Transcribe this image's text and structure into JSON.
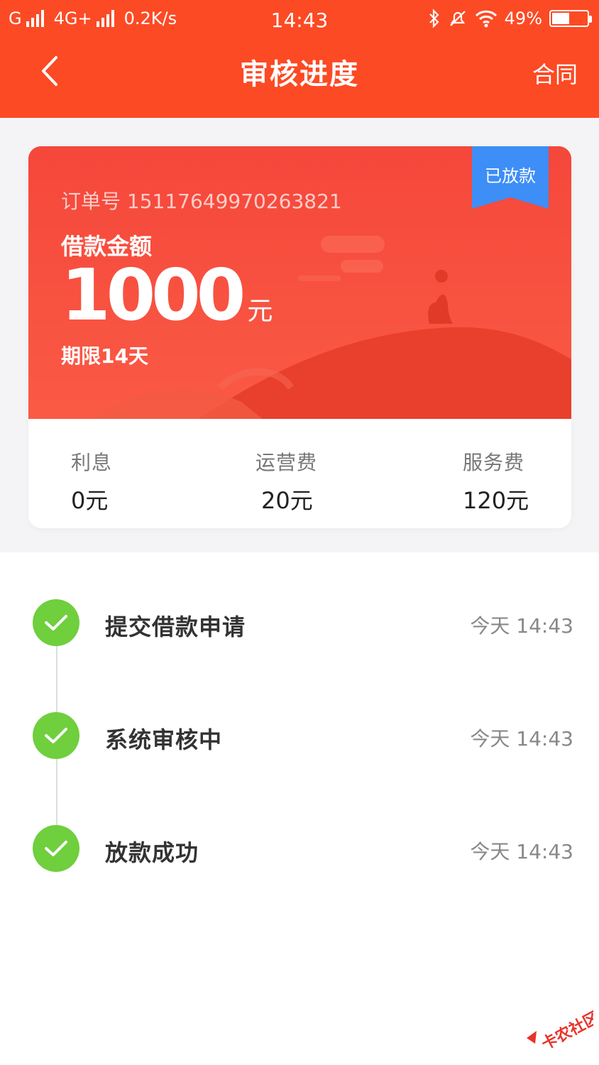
{
  "status_bar": {
    "carrier1": "G",
    "carrier2": "4G+",
    "speed": "0.2K/s",
    "time": "14:43",
    "battery": "49%",
    "battery_level": 0.49
  },
  "nav": {
    "title": "审核进度",
    "right": "合同"
  },
  "card": {
    "badge": "已放款",
    "order_label": "订单号 15117649970263821",
    "amount_label": "借款金额",
    "amount": "1000",
    "amount_unit": "元",
    "term": "期限14天",
    "fees": [
      {
        "label": "利息",
        "value": "0元"
      },
      {
        "label": "运营费",
        "value": "20元"
      },
      {
        "label": "服务费",
        "value": "120元"
      }
    ],
    "colors": {
      "card": "#f4463a",
      "badge": "#3d8ef7"
    }
  },
  "steps": [
    {
      "label": "提交借款申请",
      "time": "今天 14:43"
    },
    {
      "label": "系统审核中",
      "time": "今天 14:43"
    },
    {
      "label": "放款成功",
      "time": "今天 14:43"
    }
  ],
  "watermark": "卡农社区",
  "colors": {
    "header": "#fc4a24",
    "check": "#6fcf3d"
  }
}
